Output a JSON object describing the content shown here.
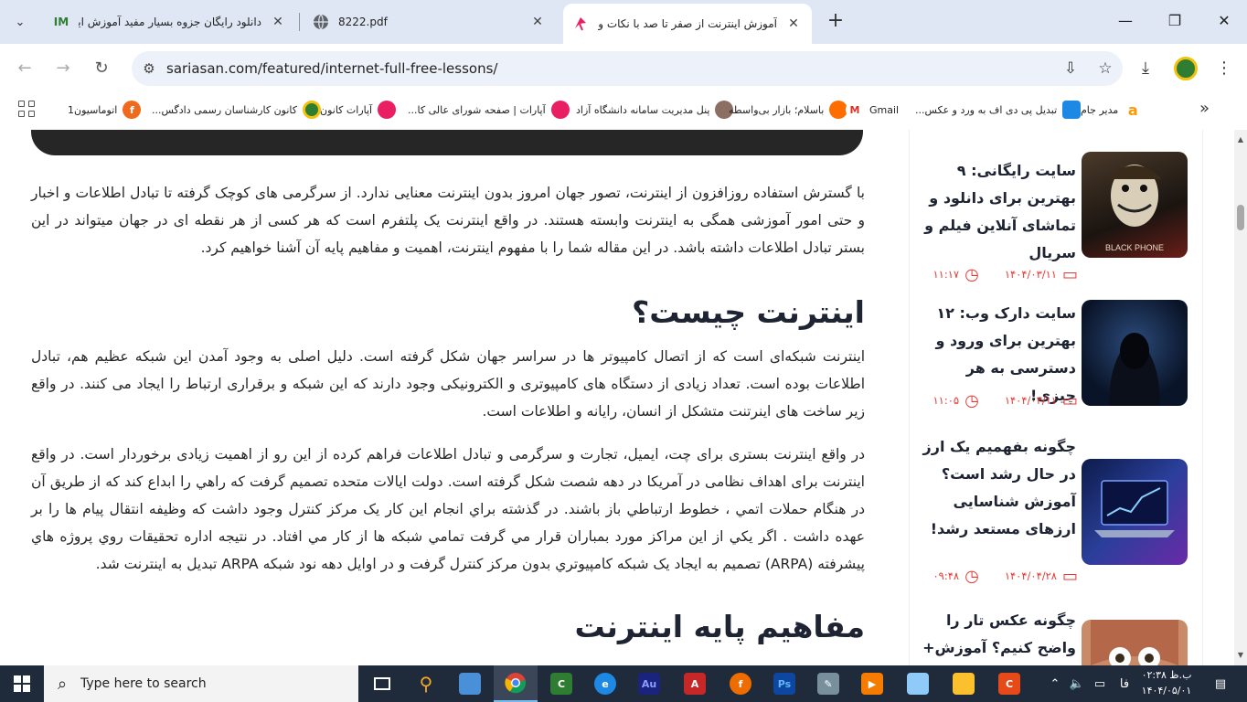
{
  "browser": {
    "tabs": [
      {
        "title": "دانلود رایگان جزوه بسیار مفید آموزش اینترنت با",
        "favicon": "IM"
      },
      {
        "title": "8222.pdf",
        "favicon": "globe-icon"
      },
      {
        "title": "آموزش اینترنت از صفر تا صد با نکات و ترفندها",
        "favicon": "sariasan-logo",
        "active": true
      }
    ],
    "url": "sariasan.com/featured/internet-full-free-lessons/",
    "bookmarks": [
      {
        "label": "اتوماسیون1",
        "color": "#f06a1e",
        "icon": "f"
      },
      {
        "label": "کانون کارشناسان رسمی دادگس...",
        "color": "#2e7d32",
        "icon": ""
      },
      {
        "label": "آپارات کانون",
        "color": "#e91e63",
        "icon": ""
      },
      {
        "label": "آپارات | صفحه شورای عالی کا...",
        "color": "#e91e63",
        "icon": ""
      },
      {
        "label": "پنل مدیریت سامانه دانشگاه آزاد",
        "color": "#8d6e63",
        "icon": ""
      },
      {
        "label": "باسلام؛ بازار بی‌واسطه",
        "color": "#ff6d00",
        "icon": ""
      },
      {
        "label": "Gmail",
        "color": "#ffffff",
        "icon": "M"
      },
      {
        "label": "تبدیل پی دی اف به ورد و عکس...",
        "color": "#1e88e5",
        "icon": ""
      },
      {
        "label": "مدیر جام",
        "color": "#ff9800",
        "icon": "a"
      }
    ]
  },
  "article": {
    "intro": "با گسترش استفاده روزافزون از اینترنت، تصور جهان امروز بدون اینترنت معنایی ندارد. از سرگرمی های کوچک گرفته تا تبادل اطلاعات و اخبار و حتی امور آموزشی همگی به اینترنت وابسته هستند. در واقع اینترنت یک پلتفرم است که هر کسی از هر نقطه ای در جهان میتواند در این بستر تبادل اطلاعات داشته باشد. در این مقاله شما را با مفهوم اینترنت، اهمیت و مفاهیم پایه آن آشنا خواهیم کرد.",
    "heading1": "اینترنت چیست؟",
    "para1": "اینترنت شبکه‌ای است که از اتصال کامپیوتر ها در سراسر جهان شکل گرفته است. دلیل اصلی به وجود آمدن این شبکه عظیم هم، تبادل اطلاعات بوده است. تعداد زیادی از دستگاه های کامپیوتری و الکترونیکی وجود دارند که این شبکه و برقراری ارتباط را ایجاد می کنند. در واقع زیر ساخت های اینرتنت متشکل از انسان، رایانه و اطلاعات است.",
    "para2": "در واقع اینترنت بستری برای چت، ایمیل، تجارت و سرگرمی و تبادل اطلاعات فراهم کرده از این رو از اهمیت زیادی برخوردار است. در واقع اینترنت برای اهداف نظامی در آمریکا در دهه شصت شکل گرفته است. دولت ایالات متحده تصمیم گرفت که راهي را ابداع کند که از طريق آن در هنگام حملات اتمي ، خطوط ارتباطي باز باشند. در گذشته براي انجام اين کار يک مرکز کنترل وجود داشت که وظيفه انتقال پيام ها را بر عهده داشت . اگر يکي از اين مراکز مورد بمباران قرار مي گرفت تمامي شبکه ها از کار مي افتاد. در نتيجه اداره تحقيقات روي پروژه هاي پيشرفته (ARPA) تصميم به ايجاد يک شبکه کامپيوتري بدون مرکز کنترل گرفت و در اوايل دهه نود شبکه ARPA تبديل به اينترنت شد.",
    "heading2": "مفاهیم پایه اینترنت"
  },
  "sidebar": {
    "posts": [
      {
        "title": "سایت رایگانی: ۹ بهترین برای دانلود و تماشای آنلاین فیلم و سریال",
        "date": "۱۴۰۴/۰۳/۱۱",
        "time": "۱۱:۱۷",
        "thumb_label": "BLACK PHONE"
      },
      {
        "title": "سایت دارک وب: ۱۲ بهترین برای ورود و دسترسی به هر چیزی!",
        "date": "۱۴۰۴/۰۳/۱۱",
        "time": "۱۱:۰۵",
        "thumb_label": ""
      },
      {
        "title": "چگونه بفهمیم یک ارز در حال رشد است؟ آموزش شناسایی ارزهای مستعد رشد!",
        "date": "۱۴۰۴/۰۴/۲۸",
        "time": "۰۹:۴۸",
        "thumb_label": ""
      },
      {
        "title": "چگونه عکس تار را واضح کنیم؟ آموزش+ معرفی",
        "date": "",
        "time": "",
        "thumb_label": ""
      }
    ]
  },
  "taskbar": {
    "search_placeholder": "Type here to search",
    "lang": "فا",
    "time": "ب.ظ ۰۲:۳۸",
    "date": "۱۴۰۴/۰۵/۰۱"
  }
}
